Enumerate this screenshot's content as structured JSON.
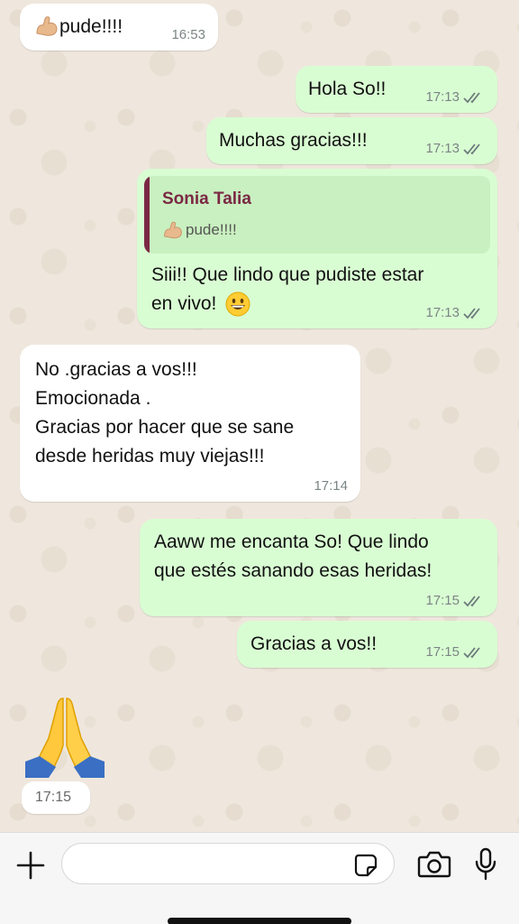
{
  "messages": [
    {
      "id": "m1",
      "side": "in",
      "emoji": "flexed-biceps",
      "text": "pude!!!!",
      "time": "16:53"
    },
    {
      "id": "m2",
      "side": "out",
      "text": "Hola So!!",
      "time": "17:13",
      "status": "read"
    },
    {
      "id": "m3",
      "side": "out",
      "text": "Muchas gracias!!!",
      "time": "17:13",
      "status": "read"
    },
    {
      "id": "m4",
      "side": "out",
      "reply": {
        "author": "Sonia Talia",
        "emoji": "flexed-biceps",
        "text": "pude!!!!"
      },
      "lines": [
        "Siii!! Que lindo que pudiste estar",
        "en vivo!"
      ],
      "trailing_emoji": "grinning-face",
      "time": "17:13",
      "status": "read"
    },
    {
      "id": "m5",
      "side": "in",
      "lines": [
        "No .gracias a vos!!!",
        "Emocionada .",
        "Gracias por hacer que se sane",
        "desde heridas muy viejas!!!"
      ],
      "time": "17:14"
    },
    {
      "id": "m6",
      "side": "out",
      "lines": [
        "Aaww me encanta So! Que lindo",
        "que estés sanando esas heridas!"
      ],
      "time": "17:15",
      "status": "read"
    },
    {
      "id": "m7",
      "side": "out",
      "text": "Gracias a vos!!",
      "time": "17:15",
      "status": "read"
    },
    {
      "id": "m8",
      "side": "in",
      "emoji": "folded-hands",
      "time": "17:15"
    }
  ],
  "composer": {
    "placeholder": "",
    "icons": [
      "plus-icon",
      "sticker-icon",
      "camera-icon",
      "microphone-icon"
    ]
  },
  "colors": {
    "outgoing_bubble": "#d9fdd3",
    "incoming_bubble": "#ffffff",
    "reply_author": "#7a2844",
    "read_ticks": "#6b7a7a",
    "wallpaper": "#efe7dd"
  }
}
